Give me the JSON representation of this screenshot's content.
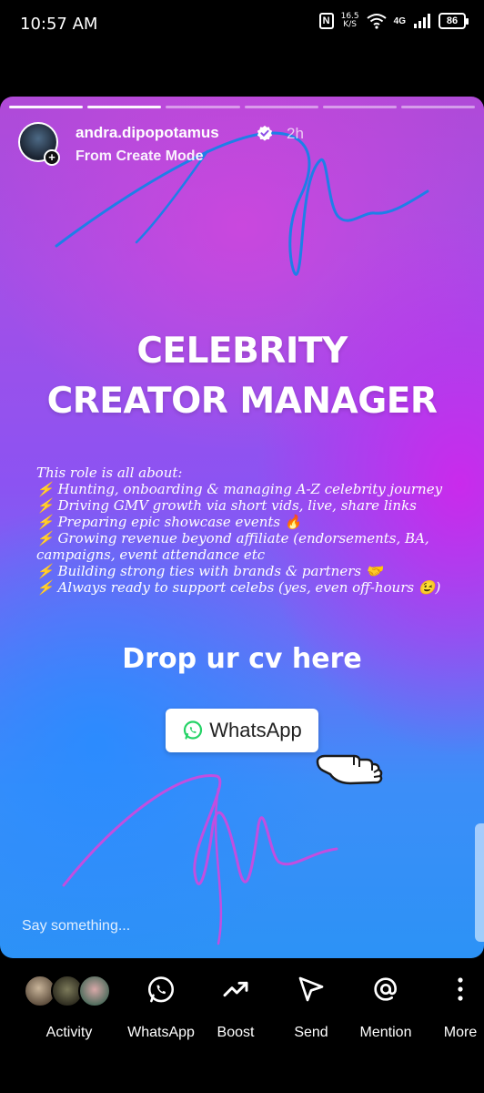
{
  "status_bar": {
    "time": "10:57 AM",
    "nfc": "N",
    "speed_value": "16.5",
    "speed_unit": "K/S",
    "network": "4G",
    "battery": "86"
  },
  "story": {
    "username": "andra.dipopotamus",
    "time_ago": "2h",
    "subtitle": "From Create Mode",
    "progress_total": 6,
    "progress_done": 2,
    "headline": [
      "CELEBRITY",
      "CREATOR MANAGER"
    ],
    "body_lines": [
      "This role is all about:",
      "⚡ Hunting, onboarding & managing A-Z celebrity journey",
      "⚡ Driving GMV growth via short vids, live, share links",
      "⚡ Preparing epic showcase events 🔥",
      "⚡ Growing revenue beyond affiliate (endorsements, BA,",
      "campaigns, event attendance  etc",
      "⚡ Building strong ties with brands & partners 🤝",
      "⚡ Always ready to support celebs (yes, even off-hours 😉)"
    ],
    "cta": "Drop ur cv here",
    "whatsapp_sticker": "WhatsApp",
    "reply_placeholder": "Say something..."
  },
  "bottom_bar": {
    "actions": [
      {
        "label": "Activity",
        "icon": "activity-avatars"
      },
      {
        "label": "WhatsApp",
        "icon": "whatsapp-icon"
      },
      {
        "label": "Boost",
        "icon": "trending-up-icon"
      },
      {
        "label": "Send",
        "icon": "send-icon"
      },
      {
        "label": "Mention",
        "icon": "at-icon"
      },
      {
        "label": "More",
        "icon": "more-vertical-icon"
      }
    ]
  },
  "colors": {
    "story_purple": "#b04ad8",
    "story_blue": "#2c92f6",
    "scribble_blue": "#1e7fe8",
    "scribble_pink": "#c24ee0",
    "whatsapp_green": "#25d366"
  }
}
